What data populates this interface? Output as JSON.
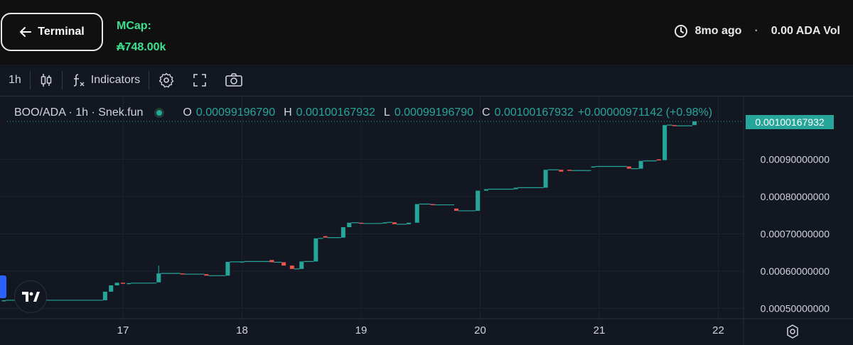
{
  "header": {
    "terminal_label": "Terminal",
    "mcap_label": "MCap:",
    "mcap_value": "₳748.00k",
    "age": "8mo ago",
    "separator": "·",
    "volume": "0.00 ADA Vol"
  },
  "toolbar": {
    "interval": "1h",
    "indicators_label": "Indicators",
    "icons": [
      "candles-icon",
      "function-icon",
      "gear-icon",
      "fullscreen-icon",
      "camera-icon"
    ]
  },
  "legend": {
    "symbol": "BOO/ADA · 1h · Snek.fun",
    "o_label": "O",
    "o_value": "0.00099196790",
    "h_label": "H",
    "h_value": "0.00100167932",
    "l_label": "L",
    "l_value": "0.00099196790",
    "c_label": "C",
    "c_value": "0.00100167932",
    "change": "+0.00000971142 (+0.98%)"
  },
  "price_tag": "0.00100167932",
  "colors": {
    "up": "#26a69a",
    "down": "#ef5350",
    "mcap": "#3ee08f"
  },
  "chart_data": {
    "type": "candlestick",
    "x_ticks": [
      "17",
      "18",
      "19",
      "20",
      "21",
      "22"
    ],
    "y_ticks": [
      "0.00050000000",
      "0.00060000000",
      "0.00070000000",
      "0.00080000000",
      "0.00090000000"
    ],
    "ylim": [
      0.00046,
      0.00102
    ],
    "grid": true,
    "candles": [
      {
        "t": 16.0,
        "o": 0.000522,
        "c": 0.000522
      },
      {
        "t": 16.85,
        "o": 0.000522,
        "c": 0.000545
      },
      {
        "t": 16.9,
        "o": 0.000545,
        "c": 0.000562
      },
      {
        "t": 16.95,
        "o": 0.000562,
        "c": 0.000569
      },
      {
        "t": 17.0,
        "o": 0.000569,
        "c": 0.000567
      },
      {
        "t": 17.05,
        "o": 0.000567,
        "c": 0.000568
      },
      {
        "t": 17.3,
        "o": 0.00057,
        "c": 0.000594,
        "h": 0.000615
      },
      {
        "t": 17.5,
        "o": 0.000594,
        "c": 0.000592
      },
      {
        "t": 17.7,
        "o": 0.000592,
        "c": 0.000588
      },
      {
        "t": 17.88,
        "o": 0.000588,
        "c": 0.000625
      },
      {
        "t": 18.0,
        "o": 0.000625,
        "c": 0.000626
      },
      {
        "t": 18.25,
        "o": 0.00063,
        "c": 0.000624
      },
      {
        "t": 18.35,
        "o": 0.000624,
        "c": 0.000615
      },
      {
        "t": 18.42,
        "o": 0.000615,
        "c": 0.000606
      },
      {
        "t": 18.5,
        "o": 0.000606,
        "c": 0.000626
      },
      {
        "t": 18.62,
        "o": 0.000626,
        "c": 0.000688
      },
      {
        "t": 18.7,
        "o": 0.000694,
        "c": 0.00069
      },
      {
        "t": 18.85,
        "o": 0.00069,
        "c": 0.000718
      },
      {
        "t": 18.9,
        "o": 0.000718,
        "c": 0.00073
      },
      {
        "t": 19.0,
        "o": 0.00073,
        "c": 0.000728
      },
      {
        "t": 19.2,
        "o": 0.000728,
        "c": 0.000731
      },
      {
        "t": 19.28,
        "o": 0.000731,
        "c": 0.000726
      },
      {
        "t": 19.4,
        "o": 0.000726,
        "c": 0.00073
      },
      {
        "t": 19.47,
        "o": 0.00073,
        "c": 0.00078
      },
      {
        "t": 19.6,
        "o": 0.00078,
        "c": 0.000778
      },
      {
        "t": 19.8,
        "o": 0.000768,
        "c": 0.000762
      },
      {
        "t": 19.98,
        "o": 0.000762,
        "c": 0.000816
      },
      {
        "t": 20.05,
        "o": 0.000816,
        "c": 0.00082
      },
      {
        "t": 20.3,
        "o": 0.00082,
        "c": 0.000824
      },
      {
        "t": 20.55,
        "o": 0.000824,
        "c": 0.000872
      },
      {
        "t": 20.68,
        "o": 0.000872,
        "c": 0.000867
      },
      {
        "t": 20.75,
        "o": 0.000872,
        "c": 0.00087
      },
      {
        "t": 20.95,
        "o": 0.00088,
        "c": 0.000881
      },
      {
        "t": 21.25,
        "o": 0.000881,
        "c": 0.000875
      },
      {
        "t": 21.35,
        "o": 0.000875,
        "c": 0.000896
      },
      {
        "t": 21.5,
        "o": 0.0009,
        "c": 0.000898
      },
      {
        "t": 21.55,
        "o": 0.000898,
        "c": 0.000992
      },
      {
        "t": 21.63,
        "o": 0.000992,
        "c": 0.00099
      },
      {
        "t": 21.8,
        "o": 0.000992,
        "c": 0.001002
      }
    ]
  }
}
